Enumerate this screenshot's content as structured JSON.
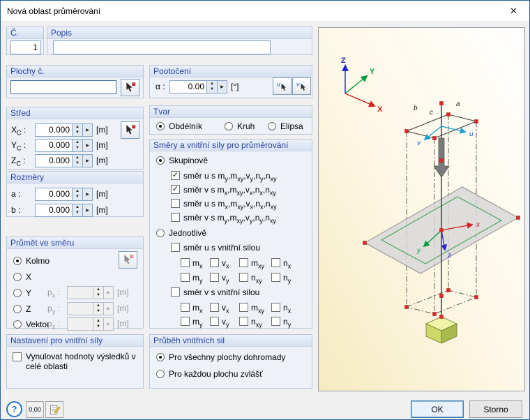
{
  "window": {
    "title": "Nová oblast průměrování"
  },
  "icons": {
    "close": "✕",
    "check": "✓",
    "spin_up": "▲",
    "spin_down": "▼",
    "expand": "▶"
  },
  "top": {
    "number": {
      "label": "Č.",
      "value": "1"
    },
    "description": {
      "label": "Popis",
      "value": ""
    }
  },
  "surfaces": {
    "title": "Plochy č.",
    "value": ""
  },
  "rotation": {
    "title": "Pootočení",
    "alpha_label": "α :",
    "value": "0.00",
    "unit": "[°]",
    "pick_u_letter": "u",
    "pick_v_letter": "v"
  },
  "center": {
    "title": "Střed",
    "rows": [
      {
        "label": "X_C :",
        "value": "0.000",
        "unit": "[m]"
      },
      {
        "label": "Y_C :",
        "value": "0.000",
        "unit": "[m]"
      },
      {
        "label": "Z_C :",
        "value": "0.000",
        "unit": "[m]"
      }
    ]
  },
  "shape": {
    "title": "Tvar",
    "options": [
      {
        "label": "Obdélník",
        "selected": true
      },
      {
        "label": "Kruh",
        "selected": false
      },
      {
        "label": "Elipsa",
        "selected": false
      }
    ]
  },
  "dimensions": {
    "title": "Rozměry",
    "rows": [
      {
        "label": "a :",
        "value": "0.000",
        "unit": "[m]"
      },
      {
        "label": "b :",
        "value": "0.000",
        "unit": "[m]"
      }
    ]
  },
  "projection": {
    "title": "Průmět ve směru",
    "options": [
      {
        "label": "Kolmo",
        "selected": true
      },
      {
        "label": "X",
        "selected": false
      },
      {
        "label": "Y",
        "selected": false
      },
      {
        "label": "Z",
        "selected": false
      },
      {
        "label": "Vektor",
        "selected": false
      }
    ],
    "p_rows": [
      {
        "label": "p_x :",
        "value": "",
        "unit": "[m]"
      },
      {
        "label": "p_y :",
        "value": "",
        "unit": "[m]"
      },
      {
        "label": "p_z :",
        "value": "",
        "unit": "[m]"
      }
    ]
  },
  "directions": {
    "title": "Směry a vnitřní síly pro průměrování",
    "group": {
      "label": "Skupinově",
      "selected": true,
      "options": [
        {
          "label": "směr u s m_y,m_xy,v_y,n_y,n_xy",
          "checked": true
        },
        {
          "label": "směr v s m_x,m_xy,v_x,n_x,n_xy",
          "checked": true
        },
        {
          "label": "směr u s m_x,m_xy,v_x,n_x,n_xy",
          "checked": false
        },
        {
          "label": "směr v s m_y,m_xy,v_y,n_y,n_xy",
          "checked": false
        }
      ]
    },
    "individual": {
      "label": "Jednotlivě",
      "selected": false,
      "sections": [
        {
          "label": "směr u s vnitřní silou",
          "checked": false,
          "forces": [
            "m_x",
            "v_x",
            "m_xy",
            "n_x",
            "m_y",
            "v_y",
            "n_xy",
            "n_y"
          ]
        },
        {
          "label": "směr v s vnitřní silou",
          "checked": false,
          "forces": [
            "m_x",
            "v_x",
            "m_xy",
            "n_x",
            "m_y",
            "v_y",
            "n_xy",
            "n_y"
          ]
        }
      ]
    }
  },
  "settings": {
    "title": "Nastavení pro vnitřní síly",
    "checkbox": {
      "label": "Vynulovat hodnoty výsledků v celé oblasti",
      "checked": false
    }
  },
  "distribution": {
    "title": "Průběh vnitřních sil",
    "options": [
      {
        "label": "Pro všechny plochy dohromady",
        "selected": true
      },
      {
        "label": "Pro každou plochu zvlášť",
        "selected": false
      }
    ]
  },
  "graphic": {
    "global_axes": {
      "x": "X",
      "y": "Y",
      "z": "Z"
    },
    "local_axes": {
      "u": "u",
      "v": "v"
    },
    "plane_axes": {
      "x": "x",
      "y": "y",
      "z": "z"
    },
    "edge_labels": {
      "a": "a",
      "b": "b",
      "c": "c"
    }
  },
  "footer": {
    "help": "?",
    "decimals": "0,00",
    "ok": "OK",
    "cancel": "Storno"
  }
}
